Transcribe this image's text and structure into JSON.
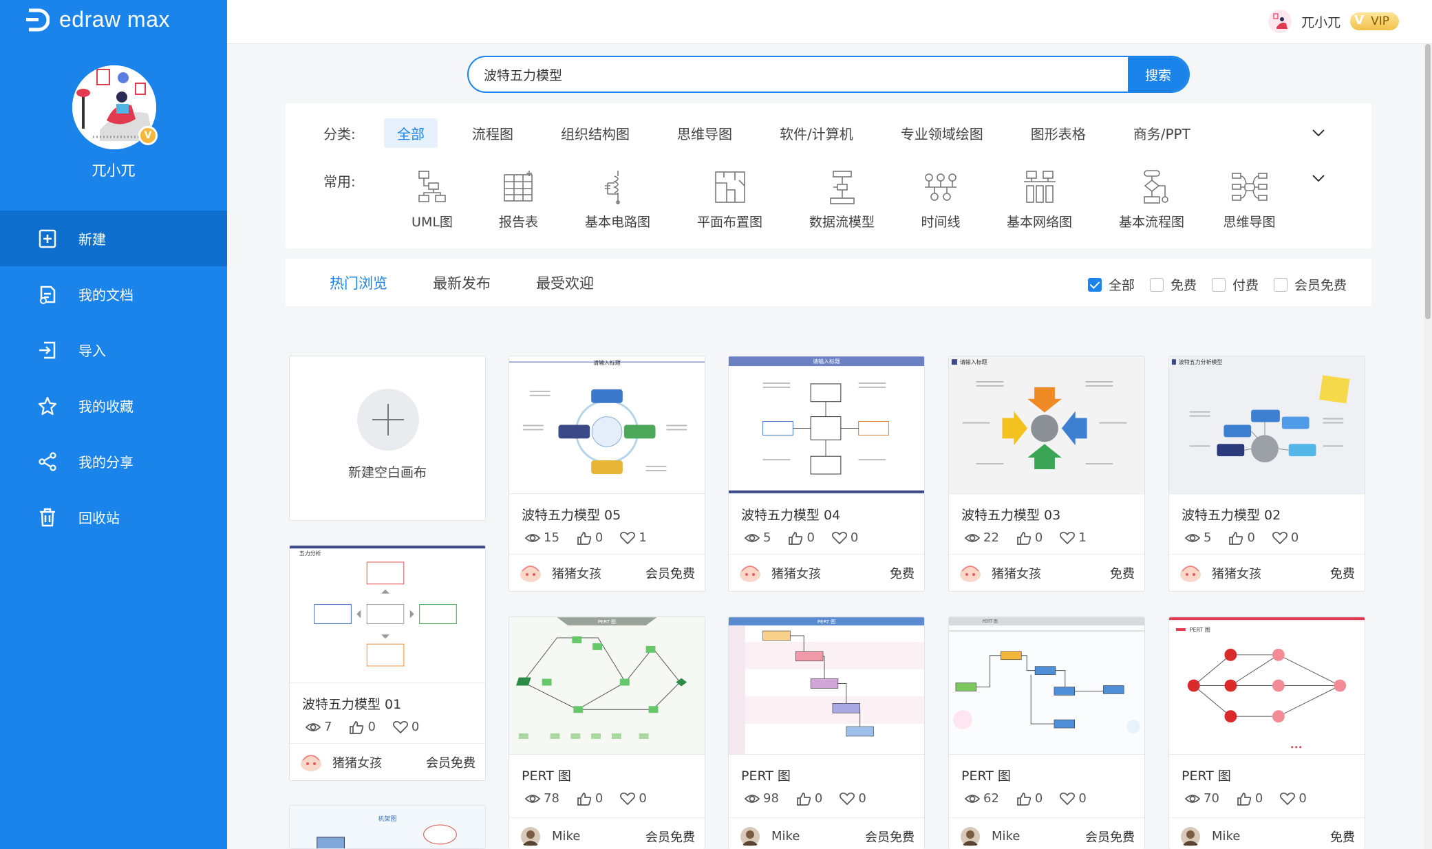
{
  "app": {
    "name": "edraw max"
  },
  "user": {
    "name": "兀小兀",
    "vip": "VIP"
  },
  "nav": [
    {
      "label": "新建",
      "icon": "new-file-icon"
    },
    {
      "label": "我的文档",
      "icon": "documents-icon"
    },
    {
      "label": "导入",
      "icon": "import-icon"
    },
    {
      "label": "我的收藏",
      "icon": "star-icon"
    },
    {
      "label": "我的分享",
      "icon": "share-icon"
    },
    {
      "label": "回收站",
      "icon": "trash-icon"
    }
  ],
  "search": {
    "value": "波特五力模型",
    "button": "搜索"
  },
  "categories": {
    "label": "分类:",
    "items": [
      "全部",
      "流程图",
      "组织结构图",
      "思维导图",
      "软件/计算机",
      "专业领域绘图",
      "图形表格",
      "商务/PPT"
    ]
  },
  "common": {
    "label": "常用:",
    "items": [
      "UML图",
      "报告表",
      "基本电路图",
      "平面布置图",
      "数据流模型",
      "时间线",
      "基本网络图",
      "基本流程图",
      "思维导图"
    ]
  },
  "sort_tabs": [
    "热门浏览",
    "最新发布",
    "最受欢迎"
  ],
  "filters": [
    {
      "label": "全部",
      "checked": true
    },
    {
      "label": "免费",
      "checked": false
    },
    {
      "label": "付费",
      "checked": false
    },
    {
      "label": "会员免费",
      "checked": false
    }
  ],
  "new_blank": "新建空白画布",
  "cards": [
    {
      "title": "波特五力模型 05",
      "views": "15",
      "likes": "0",
      "favs": "1",
      "author": "猪猪女孩",
      "price": "会员免费"
    },
    {
      "title": "波特五力模型 04",
      "views": "5",
      "likes": "0",
      "favs": "0",
      "author": "猪猪女孩",
      "price": "免费"
    },
    {
      "title": "波特五力模型 03",
      "views": "22",
      "likes": "0",
      "favs": "1",
      "author": "猪猪女孩",
      "price": "免费"
    },
    {
      "title": "波特五力模型 02",
      "views": "5",
      "likes": "0",
      "favs": "0",
      "author": "猪猪女孩",
      "price": "免费"
    },
    {
      "title": "波特五力模型 01",
      "views": "7",
      "likes": "0",
      "favs": "0",
      "author": "猪猪女孩",
      "price": "会员免费"
    },
    {
      "title": "PERT 图",
      "views": "78",
      "likes": "0",
      "favs": "0",
      "author": "Mike",
      "price": "会员免费"
    },
    {
      "title": "PERT 图",
      "views": "98",
      "likes": "0",
      "favs": "0",
      "author": "Mike",
      "price": "会员免费"
    },
    {
      "title": "PERT 图",
      "views": "62",
      "likes": "0",
      "favs": "0",
      "author": "Mike",
      "price": "会员免费"
    },
    {
      "title": "PERT 图",
      "views": "70",
      "likes": "0",
      "favs": "0",
      "author": "Mike",
      "price": "免费"
    }
  ],
  "thumb_labels": {
    "t1": "请输入标题",
    "t2": "请输入标题",
    "t3": "请输入标题",
    "t4": "波特五力分析模型",
    "t5": "五力分析",
    "pert": "PERT 图",
    "jiagou": "机架图"
  },
  "colors": {
    "brand": "#1a84ea",
    "sidebar_active": "#0f6fcf"
  }
}
